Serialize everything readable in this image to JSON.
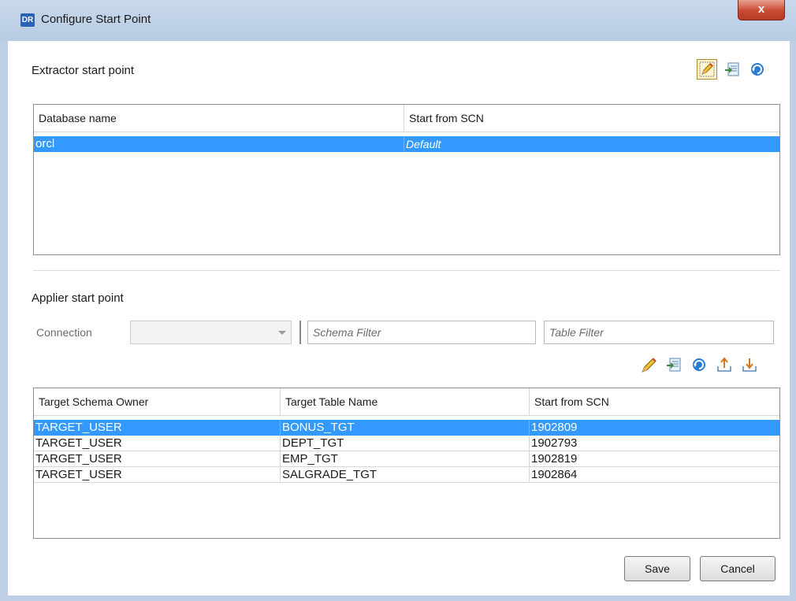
{
  "window": {
    "app_badge": "DR",
    "title": "Configure Start Point",
    "close_glyph": "x"
  },
  "extractor": {
    "section_title": "Extractor start point",
    "toolbar": [
      "pencil-edit-icon",
      "import-list-icon",
      "refresh-icon"
    ],
    "columns": [
      "Database name",
      "Start from SCN"
    ],
    "rows": [
      {
        "database": "orcl",
        "scn": "Default",
        "selected": true
      }
    ]
  },
  "applier": {
    "section_title": "Applier start point",
    "connection_label": "Connection",
    "connection_value": "",
    "schema_filter_placeholder": "Schema Filter",
    "table_filter_placeholder": "Table Filter",
    "toolbar": [
      "pencil-edit-icon",
      "import-list-icon",
      "refresh-icon",
      "export-icon",
      "import-icon"
    ],
    "columns": [
      "Target Schema Owner",
      "Target Table Name",
      "Start from SCN"
    ],
    "rows": [
      {
        "owner": "TARGET_USER",
        "table": "BONUS_TGT",
        "scn": "1902809",
        "selected": true
      },
      {
        "owner": "TARGET_USER",
        "table": "DEPT_TGT",
        "scn": "1902793",
        "selected": false
      },
      {
        "owner": "TARGET_USER",
        "table": "EMP_TGT",
        "scn": "1902819",
        "selected": false
      },
      {
        "owner": "TARGET_USER",
        "table": "SALGRADE_TGT",
        "scn": "1902864",
        "selected": false
      }
    ]
  },
  "buttons": {
    "save": "Save",
    "cancel": "Cancel"
  },
  "colors": {
    "selection": "#3399ff",
    "titlebar": "#c9d9ec",
    "close": "#c84a32"
  }
}
